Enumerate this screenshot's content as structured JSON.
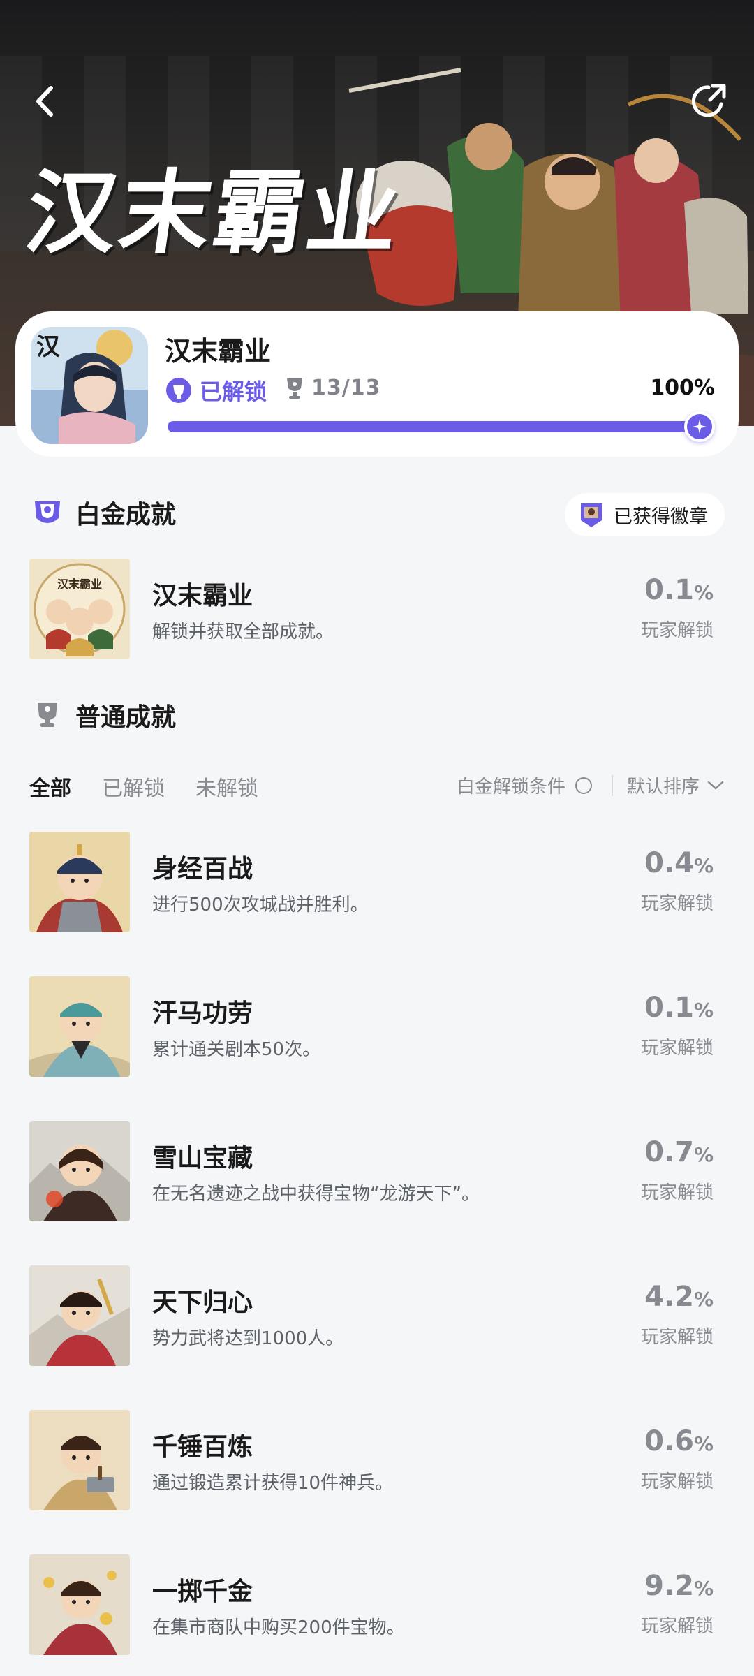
{
  "banner": {
    "title": "汉末霸业",
    "back_icon": "chevron-left-icon",
    "share_icon": "share-icon"
  },
  "summary": {
    "game_name": "汉末霸业",
    "status_label": "已解锁",
    "count": "13/13",
    "percent": "100%",
    "progress": 1.0,
    "accent_color": "#6b5ce7"
  },
  "platinum": {
    "title": "白金成就",
    "badge_button": "已获得徽章",
    "item": {
      "name": "汉末霸业",
      "desc": "解锁并获取全部成就。",
      "pct": "0.1",
      "unit": "%",
      "players": "玩家解锁"
    }
  },
  "normal": {
    "title": "普通成就",
    "tabs": [
      {
        "label": "全部",
        "active": true
      },
      {
        "label": "已解锁",
        "active": false
      },
      {
        "label": "未解锁",
        "active": false
      }
    ],
    "condition_label": "白金解锁条件",
    "sort_label": "默认排序",
    "items": [
      {
        "name": "身经百战",
        "desc": "进行500次攻城战并胜利。",
        "pct": "0.4",
        "unit": "%",
        "players": "玩家解锁"
      },
      {
        "name": "汗马功劳",
        "desc": "累计通关剧本50次。",
        "pct": "0.1",
        "unit": "%",
        "players": "玩家解锁"
      },
      {
        "name": "雪山宝藏",
        "desc": "在无名遗迹之战中获得宝物“龙游天下”。",
        "pct": "0.7",
        "unit": "%",
        "players": "玩家解锁"
      },
      {
        "name": "天下归心",
        "desc": "势力武将达到1000人。",
        "pct": "4.2",
        "unit": "%",
        "players": "玩家解锁"
      },
      {
        "name": "千锤百炼",
        "desc": "通过锻造累计获得10件神兵。",
        "pct": "0.6",
        "unit": "%",
        "players": "玩家解锁"
      },
      {
        "name": "一掷千金",
        "desc": "在集市商队中购买200件宝物。",
        "pct": "9.2",
        "unit": "%",
        "players": "玩家解锁"
      }
    ]
  }
}
